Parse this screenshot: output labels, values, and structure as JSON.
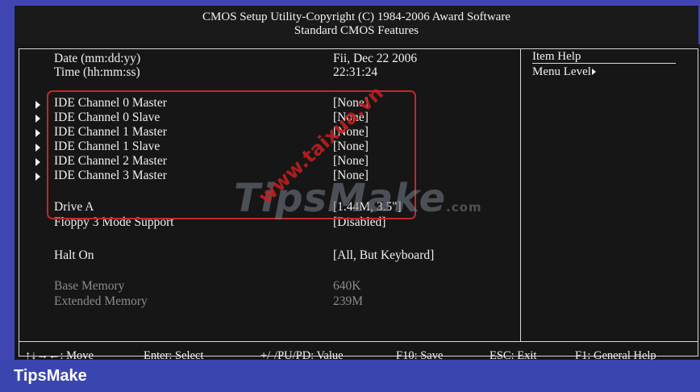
{
  "window": {
    "title_line1": "CMOS Setup Utility-Copyright (C) 1984-2006 Award Software",
    "title_line2": "Standard CMOS Features"
  },
  "settings": [
    {
      "label": "Date (mm:dd:yy)",
      "value": "Fii, Dec  22  2006",
      "submenu": false,
      "enabled": true
    },
    {
      "label": "Time (hh:mm:ss)",
      "value": "22:31:24",
      "submenu": false,
      "enabled": true
    },
    {
      "label": "IDE Channel 0 Master",
      "value": "[None]",
      "submenu": true,
      "enabled": true
    },
    {
      "label": "IDE Channel 0 Slave",
      "value": "[None]",
      "submenu": true,
      "enabled": true
    },
    {
      "label": "IDE Channel 1 Master",
      "value": "[None]",
      "submenu": true,
      "enabled": true
    },
    {
      "label": "IDE Channel 1 Slave",
      "value": "[None]",
      "submenu": true,
      "enabled": true
    },
    {
      "label": "IDE Channel 2 Master",
      "value": "[None]",
      "submenu": true,
      "enabled": true
    },
    {
      "label": "IDE Channel 3 Master",
      "value": "[None]",
      "submenu": true,
      "enabled": true
    },
    {
      "label": "Drive A",
      "value": "[1.44M, 3.5\"]",
      "submenu": false,
      "enabled": true
    },
    {
      "label": "Floppy 3 Mode Support",
      "value": "[Disabled]",
      "submenu": false,
      "enabled": true
    },
    {
      "label": "Halt On",
      "value": "[All, But Keyboard]",
      "submenu": false,
      "enabled": true
    },
    {
      "label": "Base Memory",
      "value": "640K",
      "submenu": false,
      "enabled": false
    },
    {
      "label": "Extended Memory",
      "value": "239M",
      "submenu": false,
      "enabled": false
    }
  ],
  "help_panel": {
    "title": "Item Help",
    "menu_level": "Menu Level"
  },
  "key_bar": [
    "↑↓→←: Move",
    "Enter: Select",
    "+/-/PU/PD: Value",
    "F10: Save",
    "ESC: Exit",
    "F1: General Help"
  ],
  "watermark": {
    "logo": "TipsMake",
    "logo_suffix": ".com",
    "url": "www.taixua.vn"
  },
  "footer": {
    "brand": "TipsMake"
  },
  "colors": {
    "bios_blue": "#3f46b4",
    "panel_black": "#161616",
    "highlight_red": "#c0282c"
  }
}
